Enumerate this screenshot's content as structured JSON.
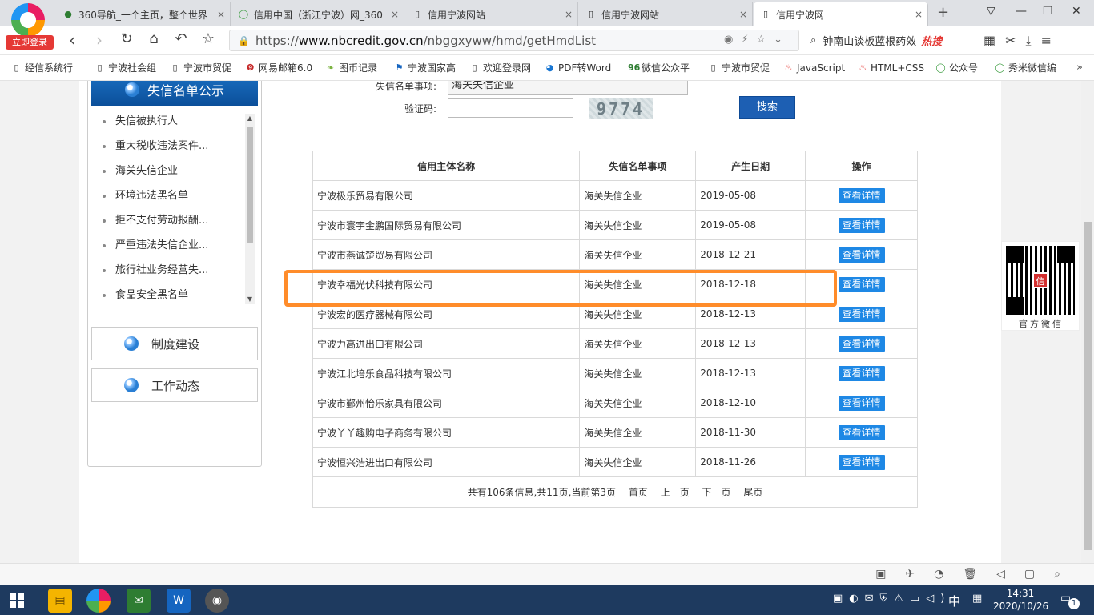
{
  "browser": {
    "login_badge": "立即登录",
    "tabs": [
      {
        "title": "360导航_一个主页，整个世界",
        "icon": "360-nav-icon"
      },
      {
        "title": "信用中国（浙江宁波）网_360",
        "icon": "search-o-icon"
      },
      {
        "title": "信用宁波网站",
        "icon": "page-icon"
      },
      {
        "title": "信用宁波网站",
        "icon": "page-icon"
      },
      {
        "title": "信用宁波网",
        "icon": "page-icon"
      }
    ],
    "url_prefix": "https://",
    "url_host": "www.nbcredit.gov.cn",
    "url_path": "/nbggxyww/hmd/getHmdList",
    "search_text": "钟南山谈板蓝根药效",
    "search_hot": "热搜",
    "bookmarks": [
      "经信系统行",
      "宁波社会组",
      "宁波市贸促",
      "网易邮箱6.0",
      "图币记录",
      "宁波国家高",
      "欢迎登录网",
      "PDF转Word",
      "微信公众平",
      "宁波市贸促",
      "JavaScript",
      "HTML+CSS",
      "公众号",
      "秀米微信编"
    ],
    "bookmark_more": "»"
  },
  "sidebar": {
    "header": "失信名单公示",
    "items": [
      "失信被执行人",
      "重大税收违法案件...",
      "海关失信企业",
      "环境违法黑名单",
      "拒不支付劳动报酬...",
      "严重违法失信企业...",
      "旅行社业务经营失...",
      "食品安全黑名单"
    ],
    "box1": "制度建设",
    "box2": "工作动态"
  },
  "form": {
    "type_label": "失信名单事项:",
    "type_value": "海关失信企业",
    "captcha_label": "验证码:",
    "captcha_value": "",
    "captcha_image_text": "9774",
    "search_button": "搜索"
  },
  "table": {
    "headers": [
      "信用主体名称",
      "失信名单事项",
      "产生日期",
      "操作"
    ],
    "detail_label": "查看详情",
    "rows": [
      {
        "name": "宁波极乐贸易有限公司",
        "item": "海关失信企业",
        "date": "2019-05-08"
      },
      {
        "name": "宁波市寰宇金鹏国际贸易有限公司",
        "item": "海关失信企业",
        "date": "2019-05-08"
      },
      {
        "name": "宁波市燕诚楚贸易有限公司",
        "item": "海关失信企业",
        "date": "2018-12-21"
      },
      {
        "name": "宁波幸福光伏科技有限公司",
        "item": "海关失信企业",
        "date": "2018-12-18"
      },
      {
        "name": "宁波宏的医疗器械有限公司",
        "item": "海关失信企业",
        "date": "2018-12-13"
      },
      {
        "name": "宁波力高进出口有限公司",
        "item": "海关失信企业",
        "date": "2018-12-13"
      },
      {
        "name": "宁波江北培乐食品科技有限公司",
        "item": "海关失信企业",
        "date": "2018-12-13"
      },
      {
        "name": "宁波市鄞州怡乐家具有限公司",
        "item": "海关失信企业",
        "date": "2018-12-10"
      },
      {
        "name": "宁波丫丫趣购电子商务有限公司",
        "item": "海关失信企业",
        "date": "2018-11-30"
      },
      {
        "name": "宁波恒兴浩进出口有限公司",
        "item": "海关失信企业",
        "date": "2018-11-26"
      }
    ],
    "pager_info": "共有106条信息,共11页,当前第3页",
    "pager_first": "首页",
    "pager_prev": "上一页",
    "pager_next": "下一页",
    "pager_last": "尾页"
  },
  "qr": {
    "label": "官方微信",
    "center_glyph": "信"
  },
  "taskbar": {
    "ime": "中",
    "time": "14:31",
    "date": "2020/10/26",
    "notifications": "1"
  },
  "colors": {
    "highlight": "#ff8c2a",
    "primary_button": "#1d5fb3",
    "detail_button": "#1e88e5"
  }
}
